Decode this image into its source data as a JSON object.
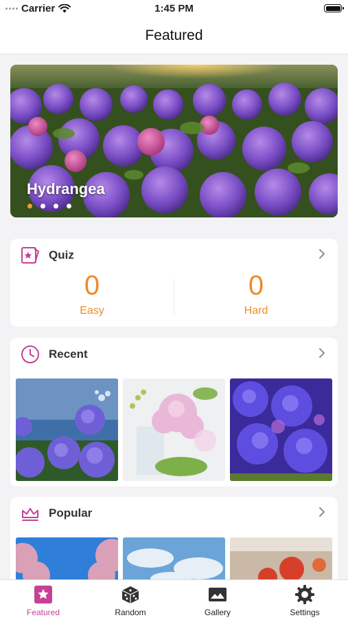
{
  "status_bar": {
    "carrier": "Carrier",
    "time": "1:45 PM"
  },
  "nav": {
    "title": "Featured"
  },
  "hero": {
    "title": "Hydrangea",
    "page_count": 4,
    "active_page": 0
  },
  "quiz": {
    "title": "Quiz",
    "easy": {
      "value": "0",
      "label": "Easy"
    },
    "hard": {
      "value": "0",
      "label": "Hard"
    }
  },
  "recent": {
    "title": "Recent"
  },
  "popular": {
    "title": "Popular"
  },
  "tabs": [
    {
      "label": "Featured",
      "icon": "star-icon",
      "active": true
    },
    {
      "label": "Random",
      "icon": "dice-icon",
      "active": false
    },
    {
      "label": "Gallery",
      "icon": "photo-icon",
      "active": false
    },
    {
      "label": "Settings",
      "icon": "gear-icon",
      "active": false
    }
  ],
  "colors": {
    "accent": "#c54196",
    "number": "#ee8b2b",
    "background": "#f3f3f5"
  }
}
